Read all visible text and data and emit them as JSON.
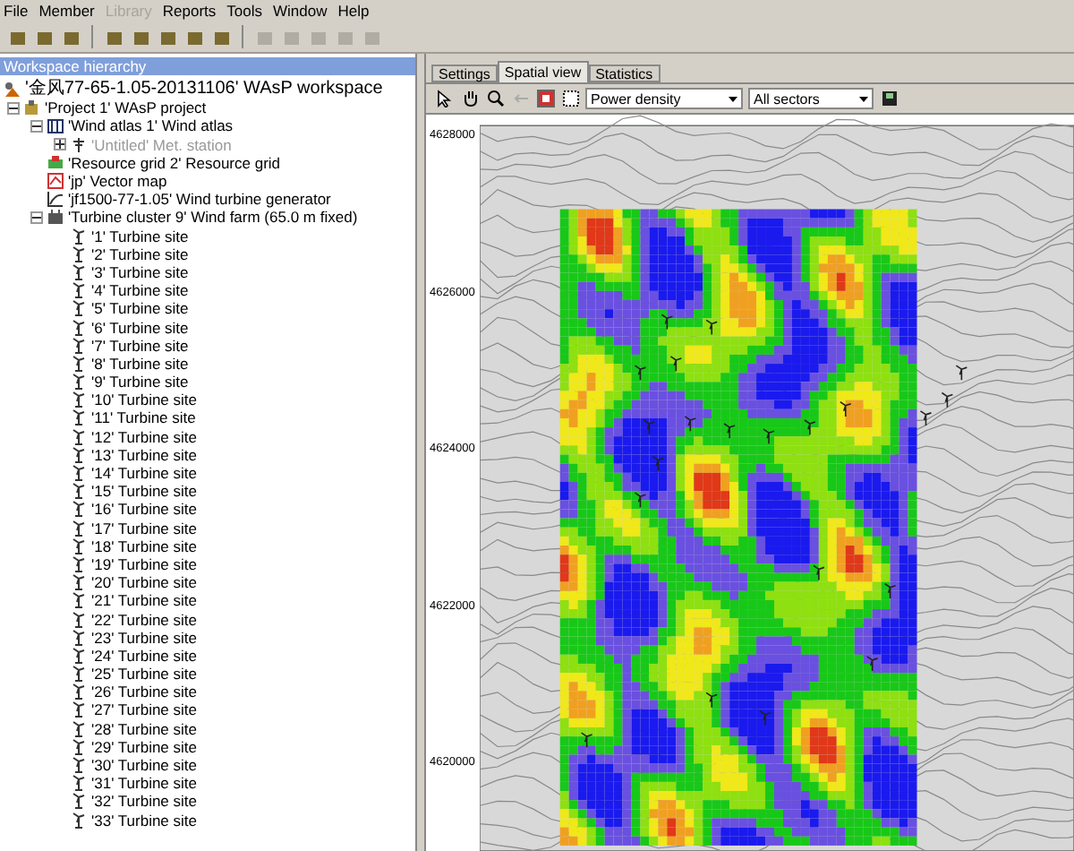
{
  "menu": [
    {
      "label": "File",
      "disabled": false
    },
    {
      "label": "Member",
      "disabled": false
    },
    {
      "label": "Library",
      "disabled": true
    },
    {
      "label": "Reports",
      "disabled": false
    },
    {
      "label": "Tools",
      "disabled": false
    },
    {
      "label": "Window",
      "disabled": false
    },
    {
      "label": "Help",
      "disabled": false
    }
  ],
  "hierarchy": {
    "title": "Workspace hierarchy",
    "tree": [
      {
        "label": "'金风77-65-1.05-20131106' WAsP workspace",
        "kind": "workspace",
        "disabled": false,
        "children": [
          {
            "label": "'Project 1' WAsP project",
            "kind": "project",
            "expanded": true,
            "disabled": false,
            "children": [
              {
                "label": "'Wind atlas 1' Wind atlas",
                "kind": "atlas",
                "expanded": true,
                "disabled": false,
                "children": [
                  {
                    "label": "'Untitled' Met. station",
                    "kind": "met_station",
                    "expanded": false,
                    "disabled": true
                  }
                ]
              },
              {
                "label": "'Resource grid 2' Resource grid",
                "kind": "resource_grid",
                "disabled": false
              },
              {
                "label": "'jp' Vector map",
                "kind": "vector_map",
                "disabled": false
              },
              {
                "label": "'jf1500-77-1.05' Wind turbine generator",
                "kind": "turbine_generator",
                "disabled": false
              },
              {
                "label": "'Turbine cluster 9' Wind farm (65.0 m fixed)",
                "kind": "wind_farm",
                "expanded": true,
                "disabled": false,
                "children": [
                  {
                    "label": "'1' Turbine site",
                    "kind": "turbine_site",
                    "disabled": false
                  },
                  {
                    "label": "'2' Turbine site",
                    "kind": "turbine_site",
                    "disabled": false
                  },
                  {
                    "label": "'3' Turbine site",
                    "kind": "turbine_site",
                    "disabled": false
                  },
                  {
                    "label": "'4' Turbine site",
                    "kind": "turbine_site",
                    "disabled": false
                  },
                  {
                    "label": "'5' Turbine site",
                    "kind": "turbine_site",
                    "disabled": false
                  },
                  {
                    "label": "'6' Turbine site",
                    "kind": "turbine_site",
                    "disabled": false
                  },
                  {
                    "label": "'7' Turbine site",
                    "kind": "turbine_site",
                    "disabled": false
                  },
                  {
                    "label": "'8' Turbine site",
                    "kind": "turbine_site",
                    "disabled": false
                  },
                  {
                    "label": "'9' Turbine site",
                    "kind": "turbine_site",
                    "disabled": false
                  },
                  {
                    "label": "'10' Turbine site",
                    "kind": "turbine_site",
                    "disabled": false
                  },
                  {
                    "label": "'11' Turbine site",
                    "kind": "turbine_site",
                    "disabled": false
                  },
                  {
                    "label": "'12' Turbine site",
                    "kind": "turbine_site",
                    "disabled": false
                  },
                  {
                    "label": "'13' Turbine site",
                    "kind": "turbine_site",
                    "disabled": false
                  },
                  {
                    "label": "'14' Turbine site",
                    "kind": "turbine_site",
                    "disabled": false
                  },
                  {
                    "label": "'15' Turbine site",
                    "kind": "turbine_site",
                    "disabled": false
                  },
                  {
                    "label": "'16' Turbine site",
                    "kind": "turbine_site",
                    "disabled": false
                  },
                  {
                    "label": "'17' Turbine site",
                    "kind": "turbine_site",
                    "disabled": false
                  },
                  {
                    "label": "'18' Turbine site",
                    "kind": "turbine_site",
                    "disabled": false
                  },
                  {
                    "label": "'19' Turbine site",
                    "kind": "turbine_site",
                    "disabled": false
                  },
                  {
                    "label": "'20' Turbine site",
                    "kind": "turbine_site",
                    "disabled": false
                  },
                  {
                    "label": "'21' Turbine site",
                    "kind": "turbine_site",
                    "disabled": false
                  },
                  {
                    "label": "'22' Turbine site",
                    "kind": "turbine_site",
                    "disabled": false
                  },
                  {
                    "label": "'23' Turbine site",
                    "kind": "turbine_site",
                    "disabled": false
                  },
                  {
                    "label": "'24' Turbine site",
                    "kind": "turbine_site",
                    "disabled": false
                  },
                  {
                    "label": "'25' Turbine site",
                    "kind": "turbine_site",
                    "disabled": false
                  },
                  {
                    "label": "'26' Turbine site",
                    "kind": "turbine_site",
                    "disabled": false
                  },
                  {
                    "label": "'27' Turbine site",
                    "kind": "turbine_site",
                    "disabled": false
                  },
                  {
                    "label": "'28' Turbine site",
                    "kind": "turbine_site",
                    "disabled": false
                  },
                  {
                    "label": "'29' Turbine site",
                    "kind": "turbine_site",
                    "disabled": false
                  },
                  {
                    "label": "'30' Turbine site",
                    "kind": "turbine_site",
                    "disabled": false
                  },
                  {
                    "label": "'31' Turbine site",
                    "kind": "turbine_site",
                    "disabled": false
                  },
                  {
                    "label": "'32' Turbine site",
                    "kind": "turbine_site",
                    "disabled": false
                  },
                  {
                    "label": "'33' Turbine site",
                    "kind": "turbine_site",
                    "disabled": false
                  }
                ]
              }
            ]
          }
        ]
      }
    ]
  },
  "view": {
    "tabs": [
      {
        "label": "Settings",
        "selected": false
      },
      {
        "label": "Spatial view",
        "selected": true
      },
      {
        "label": "Statistics",
        "selected": false
      }
    ],
    "variable": "Power density",
    "sectors": "All sectors",
    "y_labels": [
      "4628000",
      "4626000",
      "4624000",
      "4622000",
      "4620000"
    ]
  }
}
